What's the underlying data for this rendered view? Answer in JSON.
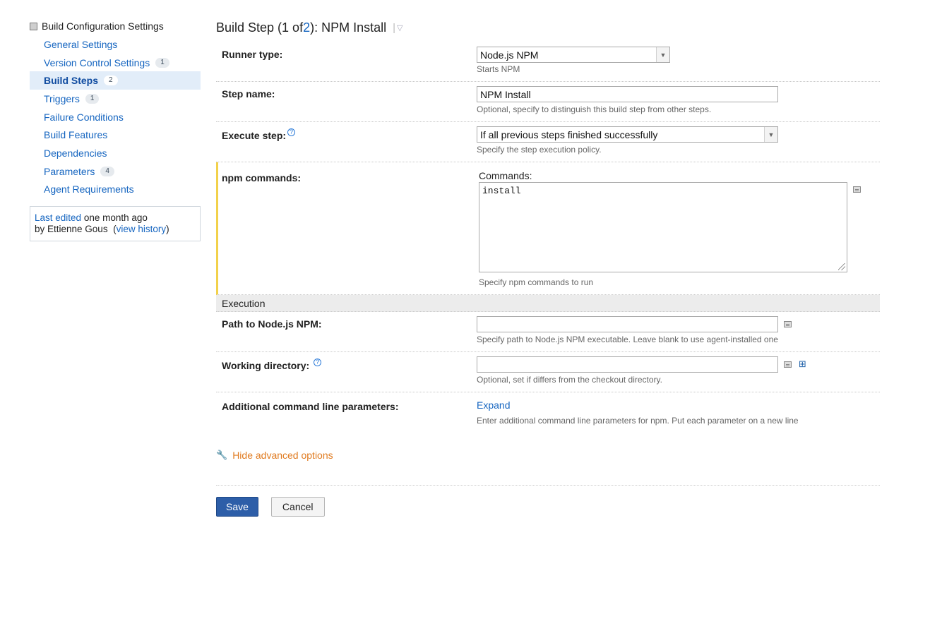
{
  "sidebar": {
    "header": "Build Configuration Settings",
    "items": [
      {
        "label": "General Settings",
        "badge": ""
      },
      {
        "label": "Version Control Settings",
        "badge": "1"
      },
      {
        "label": "Build Steps",
        "badge": "2"
      },
      {
        "label": "Triggers",
        "badge": "1"
      },
      {
        "label": "Failure Conditions",
        "badge": ""
      },
      {
        "label": "Build Features",
        "badge": ""
      },
      {
        "label": "Dependencies",
        "badge": ""
      },
      {
        "label": "Parameters",
        "badge": "4"
      },
      {
        "label": "Agent Requirements",
        "badge": ""
      }
    ],
    "active_index": 2,
    "last_edited": {
      "link": "Last edited",
      "when": "one month ago",
      "by": "by Ettienne Gous",
      "history_link": "view history"
    }
  },
  "main": {
    "title": {
      "prefix": "Build Step (1 of ",
      "total": "2",
      "suffix": "): NPM Install"
    },
    "runner_type": {
      "label": "Runner type:",
      "value": "Node.js NPM",
      "note": "Starts NPM"
    },
    "step_name": {
      "label": "Step name:",
      "value": "NPM Install",
      "note": "Optional, specify to distinguish this build step from other steps."
    },
    "execute_step": {
      "label": "Execute step:",
      "value": "If all previous steps finished successfully",
      "note": "Specify the step execution policy."
    },
    "npm_commands": {
      "label": "npm commands:",
      "field_label": "Commands:",
      "value": "install",
      "note": "Specify npm commands to run"
    },
    "execution_section": "Execution",
    "path_npm": {
      "label": "Path to Node.js NPM:",
      "value": "",
      "note": "Specify path to Node.js NPM executable. Leave blank to use agent-installed one"
    },
    "working_dir": {
      "label": "Working directory:",
      "value": "",
      "note": "Optional, set if differs from the checkout directory."
    },
    "additional_params": {
      "label": "Additional command line parameters:",
      "link": "Expand",
      "note": "Enter additional command line parameters for npm. Put each parameter on a new line"
    },
    "advanced_toggle": "Hide advanced options",
    "save_label": "Save",
    "cancel_label": "Cancel"
  },
  "colors": {
    "link": "#1565c0",
    "active_bg": "#e2edf9",
    "save_button": "#2d5ea8",
    "advanced": "#e07a1e",
    "highlight_bar": "#f2d14b"
  }
}
